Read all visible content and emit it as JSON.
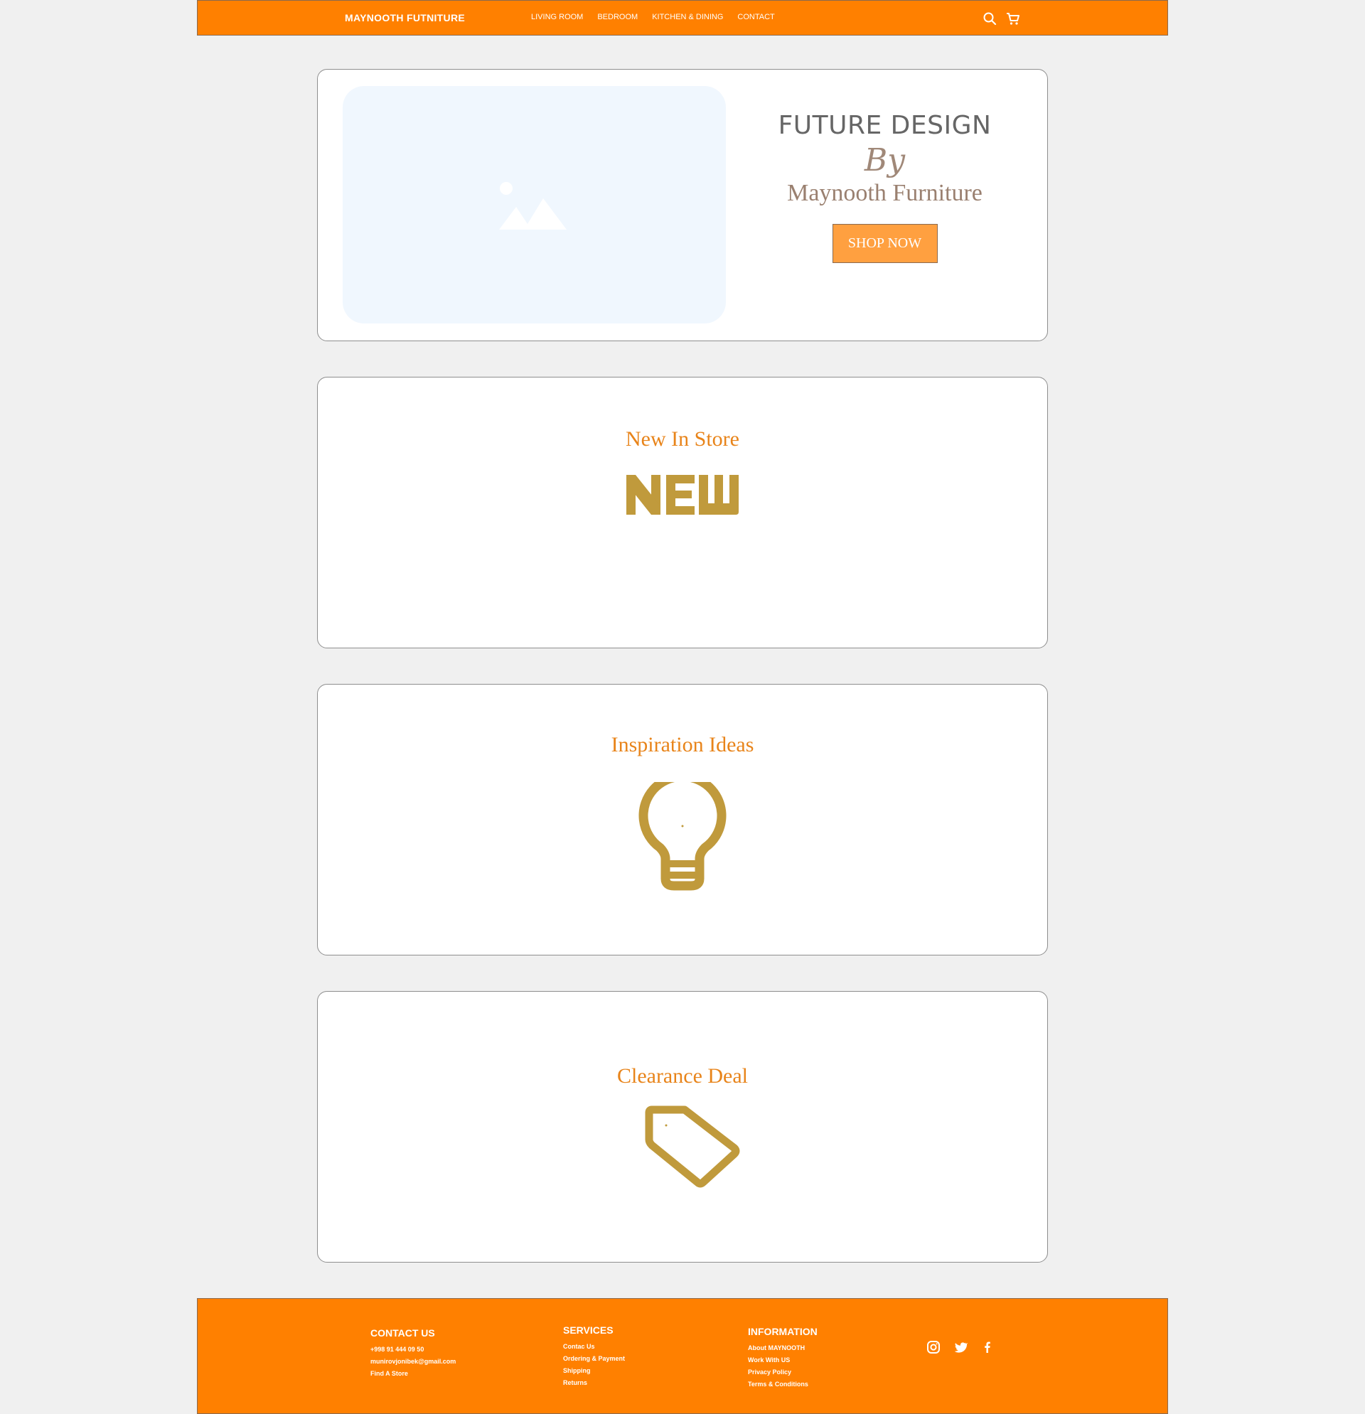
{
  "header": {
    "brand": "MAYNOOTH FUTNITURE",
    "nav": [
      "LIVING ROOM",
      "BEDROOM",
      "KITCHEN & DINING",
      "CONTACT"
    ],
    "icons": [
      "search-icon",
      "cart-icon"
    ]
  },
  "hero": {
    "title": "FUTURE DESIGN",
    "by": "By",
    "subtitle": "Maynooth Furniture",
    "button": "SHOP NOW"
  },
  "sections": {
    "new": {
      "title": "New In Store",
      "icon": "new-badge-icon"
    },
    "inspiration": {
      "title": "Inspiration Ideas",
      "icon": "lightbulb-icon"
    },
    "clearance": {
      "title": "Clearance Deal",
      "icon": "price-tag-icon"
    }
  },
  "footer": {
    "contact": {
      "heading": "CONTACT US",
      "items": [
        "+998 91 444 09 50",
        "munirovjonibek@gmail.com",
        "Find A Store"
      ]
    },
    "services": {
      "heading": "SERVICES",
      "items": [
        "Contac Us",
        "Ordering & Payment",
        "Shipping",
        "Returns"
      ]
    },
    "information": {
      "heading": "INFORMATION",
      "items": [
        "About MAYNOOTH",
        "Work With US",
        "Privacy Policy",
        "Terms & Conditions"
      ]
    },
    "social": [
      "instagram-icon",
      "twitter-icon",
      "facebook-icon"
    ]
  },
  "colors": {
    "brand_orange": "#ff8000",
    "button_orange": "#ffa040",
    "icon_gold": "#c09a3c",
    "section_title": "#e8841a",
    "page_bg": "#f0f0f0"
  }
}
